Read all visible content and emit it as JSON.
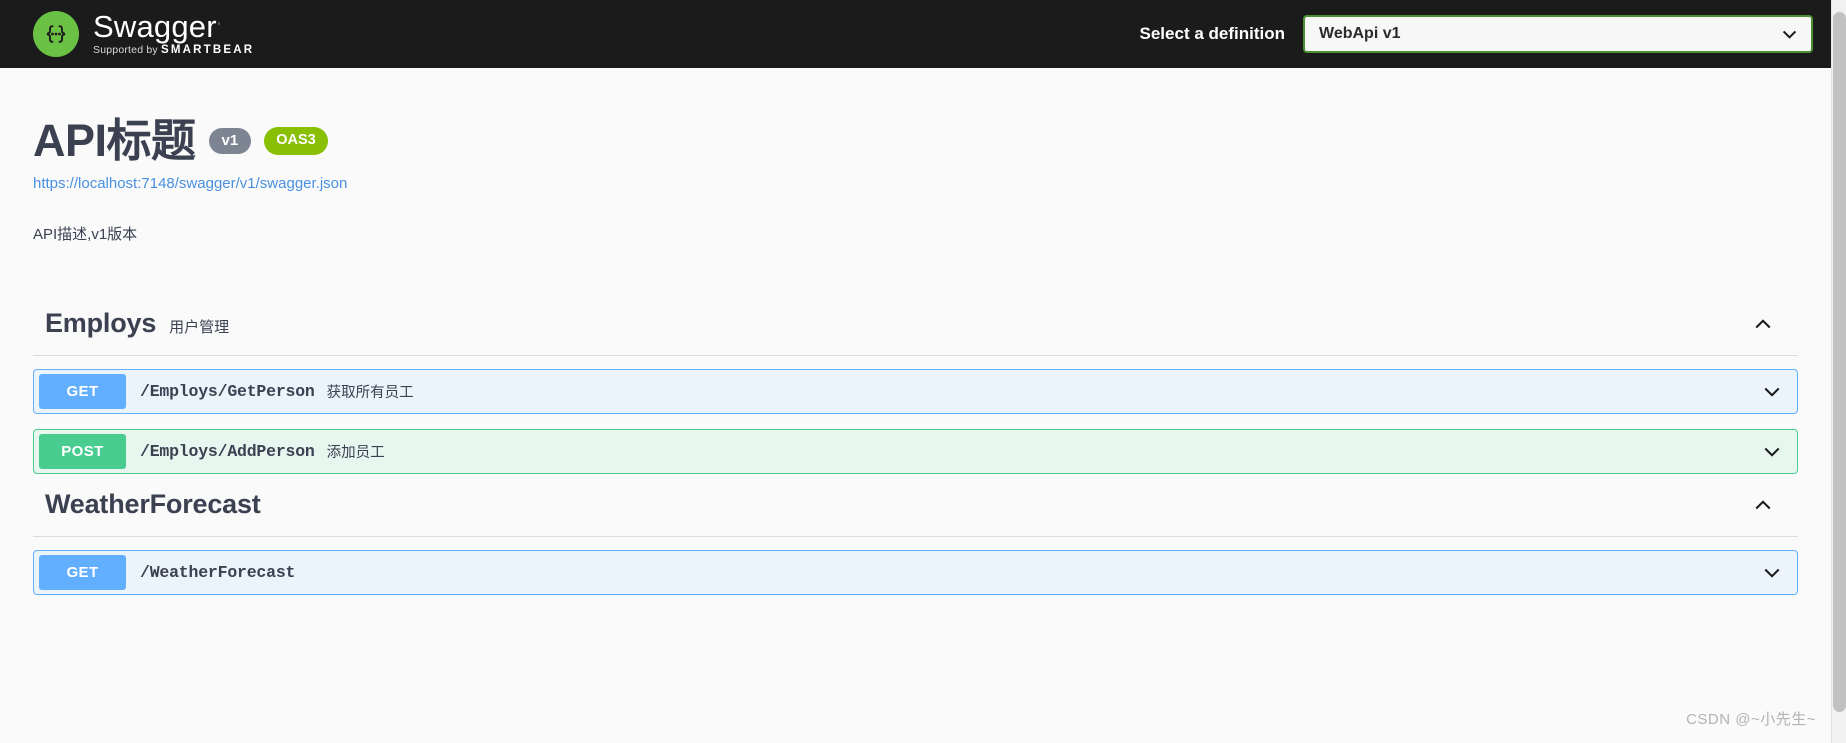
{
  "topbar": {
    "logo_title": "Swagger",
    "logo_trademark": " ",
    "logo_supported_prefix": "Supported by",
    "logo_supported_brand": "SMARTBEAR",
    "logo_icon": "swagger-braces-icon",
    "definition_label": "Select a definition",
    "definition_value": "WebApi v1",
    "definition_arrow_icon": "chevron-down-icon",
    "background_color": "#1b1b1b",
    "accent_green": "#6ac144",
    "select_border_color": "#4c8f2f"
  },
  "info": {
    "title": "API标题",
    "version_badge": "v1",
    "oas_badge": "OAS3",
    "url": "https://localhost:7148/swagger/v1/swagger.json",
    "description": "API描述,v1版本",
    "version_badge_color": "#7d8492",
    "oas_badge_color": "#89bf04",
    "url_color": "#4990e2"
  },
  "tags": [
    {
      "name": "Employs",
      "description": "用户管理",
      "toggle_icon": "chevron-up-icon",
      "expanded": true,
      "operations": [
        {
          "method": "GET",
          "path": "/Employs/GetPerson",
          "summary": "获取所有员工",
          "toggle_icon": "chevron-down-icon",
          "method_color": "#61affe",
          "row_background": "#ebf3fb"
        },
        {
          "method": "POST",
          "path": "/Employs/AddPerson",
          "summary": "添加员工",
          "toggle_icon": "chevron-down-icon",
          "method_color": "#49cc90",
          "row_background": "#e8f6f0"
        }
      ]
    },
    {
      "name": "WeatherForecast",
      "description": "",
      "toggle_icon": "chevron-up-icon",
      "expanded": true,
      "operations": [
        {
          "method": "GET",
          "path": "/WeatherForecast",
          "summary": "",
          "toggle_icon": "chevron-down-icon",
          "method_color": "#61affe",
          "row_background": "#ebf3fb"
        }
      ]
    }
  ],
  "watermark": "CSDN @~小先生~"
}
